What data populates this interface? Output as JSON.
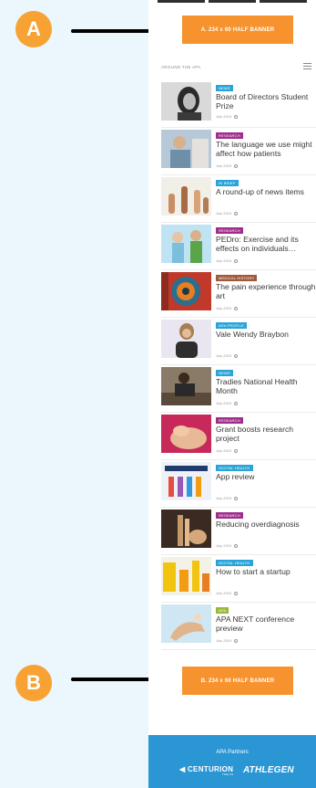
{
  "banners": {
    "a_label": "A. 234 x 60 HALF BANNER",
    "b_label": "B. 234 x 60 HALF BANNER",
    "color": "#f7932f"
  },
  "section": {
    "title": "AROUND THE APA",
    "menu_icon": "hamburger-menu-icon"
  },
  "articles": [
    {
      "tag": "NEWS",
      "tag_color": "#2aa4d8",
      "title": "Board of Directors Student Prize",
      "date": "July 2019"
    },
    {
      "tag": "RESEARCH",
      "tag_color": "#a02d8c",
      "title": "The language we use might affect how patients",
      "date": "July 2019"
    },
    {
      "tag": "IN BRIEF",
      "tag_color": "#2aa4d8",
      "title": "A round-up of news items",
      "date": "July 2019"
    },
    {
      "tag": "RESEARCH",
      "tag_color": "#a02d8c",
      "title": "PEDro: Exercise and its effects on individuals…",
      "date": "July 2019"
    },
    {
      "tag": "MEDICAL HISTORY",
      "tag_color": "#a05a3a",
      "title": "The pain experience through art",
      "date": "July 2019"
    },
    {
      "tag": "APA PROFILE",
      "tag_color": "#2aa4d8",
      "title": "Vale Wendy Braybon",
      "date": "July 2019"
    },
    {
      "tag": "NEWS",
      "tag_color": "#2aa4d8",
      "title": "Tradies National Health Month",
      "date": "July 2019"
    },
    {
      "tag": "RESEARCH",
      "tag_color": "#a02d8c",
      "title": "Grant boosts research project",
      "date": "July 2019"
    },
    {
      "tag": "DIGITAL HEALTH",
      "tag_color": "#2aa4d8",
      "title": "App review",
      "date": "July 2019"
    },
    {
      "tag": "RESEARCH",
      "tag_color": "#a02d8c",
      "title": "Reducing overdiagnosis",
      "date": "July 2019"
    },
    {
      "tag": "DIGITAL HEALTH",
      "tag_color": "#2aa4d8",
      "title": "How to start a startup",
      "date": "July 2019"
    },
    {
      "tag": "APA",
      "tag_color": "#9ab73b",
      "title": "APA NEXT conference preview",
      "date": "July 2019"
    }
  ],
  "markers": {
    "a": "A",
    "b": "B",
    "color": "#f7a233"
  },
  "footer": {
    "title": "APA Partners",
    "logo1": "CENTURION",
    "logo1_sub": "THELIS",
    "logo2": "ATHLEGEN",
    "color": "#2a96d4"
  }
}
